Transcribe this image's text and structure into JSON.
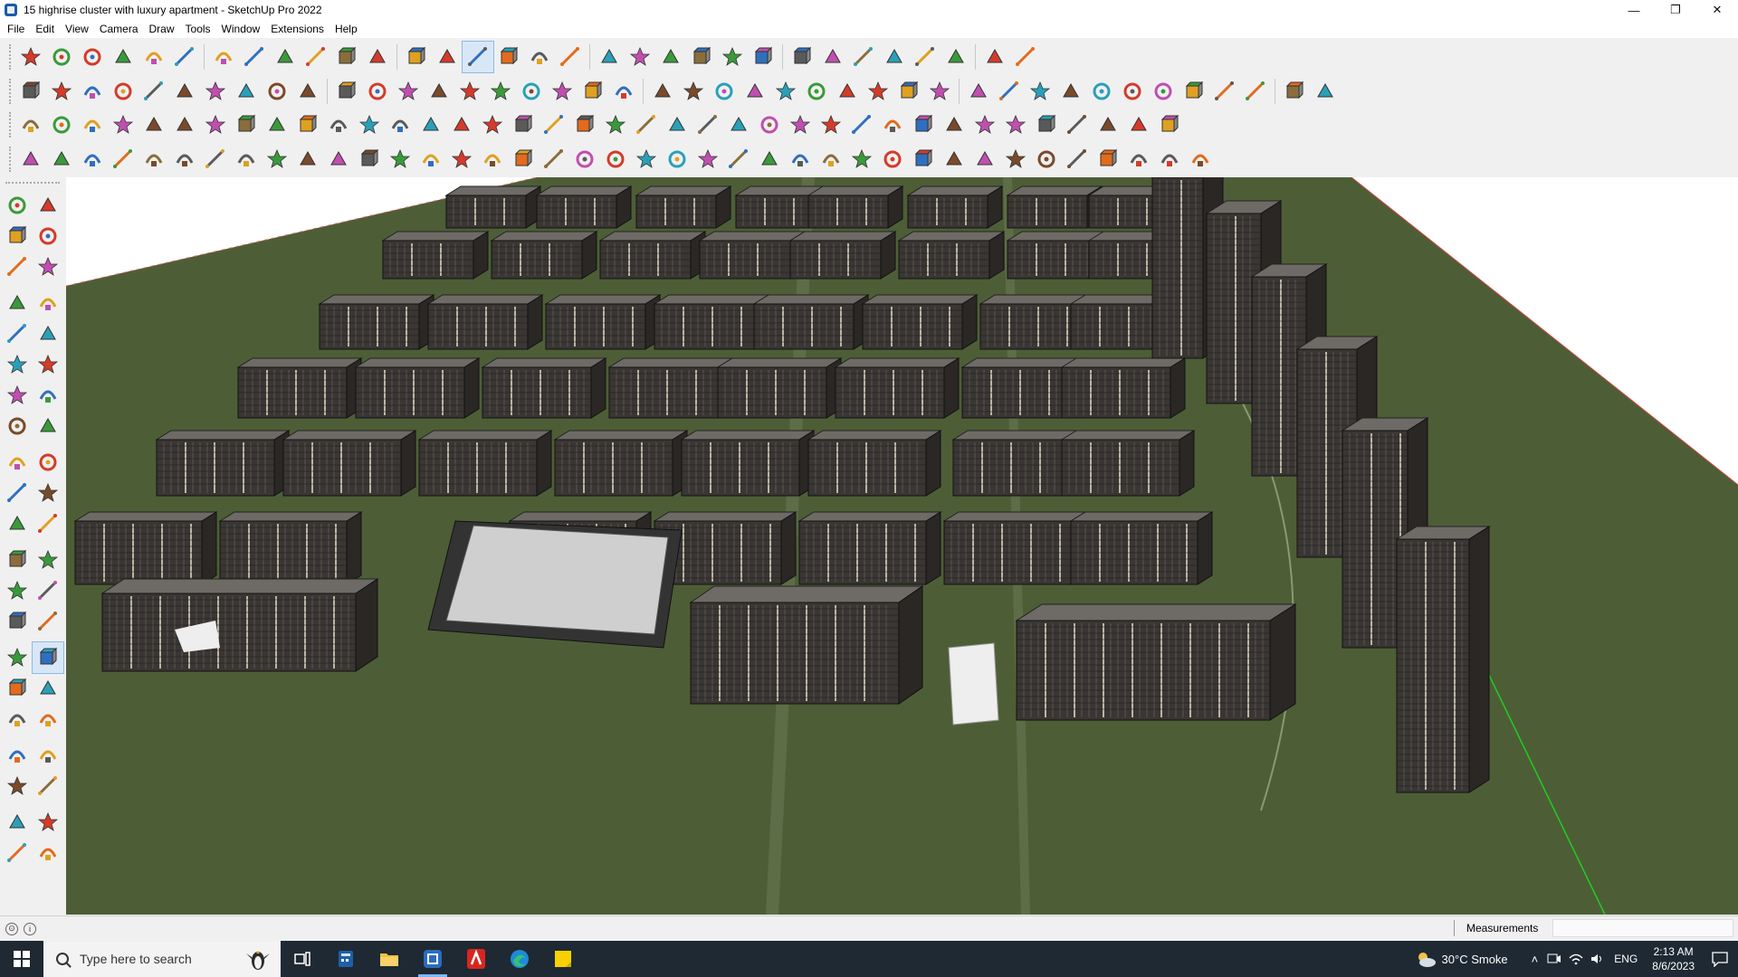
{
  "window": {
    "title": "15 highrise cluster with luxury apartment - SketchUp Pro 2022",
    "minimize_glyph": "—",
    "restore_glyph": "❐",
    "close_glyph": "✕"
  },
  "menu": [
    "File",
    "Edit",
    "View",
    "Camera",
    "Draw",
    "Tools",
    "Window",
    "Extensions",
    "Help"
  ],
  "toolbar_icons": {
    "row1": [
      "zoom-search-icon",
      "select-arrow-icon",
      "eraser-icon",
      "pencil-line-icon",
      "freehand-icon",
      "rectangle-icon",
      "move-icon",
      "rotate-icon",
      "scale-icon",
      "offset-icon",
      "tape-measure-icon",
      "text-label-icon",
      "paint-bucket-icon",
      "orbit-icon",
      "pan-icon",
      "zoom-icon",
      "zoom-extents-icon",
      "component-icon",
      "section-plane-icon",
      "layers-icon",
      "styles-icon",
      "account-icon",
      "scene-icon",
      "color-icon",
      "axes-icon",
      "sort-up-icon",
      "sort-down-icon",
      "expand-icon",
      "fit-icon",
      "undo-icon",
      "redo-icon",
      "share-icon"
    ],
    "row2": [
      "box-solid-icon",
      "box-xray-icon",
      "box-shaded-icon",
      "push-pull-icon",
      "extrude-icon",
      "bevel-icon",
      "chamfer-icon",
      "fillet-icon",
      "shell-icon",
      "split-icon",
      "curve-icon",
      "plane-icon",
      "plane-alt-icon",
      "plane-mirror-icon",
      "roof-icon",
      "roof-alt-icon",
      "house-icon",
      "house-alt-icon",
      "house-outline-icon",
      "garage-icon",
      "formula-icon",
      "leaf-icon",
      "ruler-icon",
      "ellipse-icon",
      "circle-icon",
      "hexagon-icon",
      "oval-icon",
      "polygon-icon",
      "wave-icon",
      "arc-icon",
      "freeform-icon",
      "stamp-icon",
      "knot-icon",
      "red-line-icon",
      "tag-icon",
      "cube-brown-icon",
      "grid-icon",
      "mesh-icon",
      "terrain-icon",
      "teapot-icon",
      "box-flat-icon",
      "box-render-icon"
    ],
    "row3": [
      "blue-plane-icon",
      "blue-solid-icon",
      "yellow-plane-icon",
      "green-plane-icon",
      "red-plane-icon",
      "white-plane-icon",
      "loop-icon",
      "red-square-icon",
      "stack-icon",
      "path-icon",
      "bridge-icon",
      "pipe-icon",
      "corner-icon",
      "dotted-curve-icon",
      "red-cross-icon",
      "green-cross-icon",
      "blue-cross-icon",
      "cone-icon",
      "water-icon",
      "warning-icon",
      "hook-icon",
      "wave-orange-icon",
      "spiral-icon",
      "arrows-icon",
      "bucket-icon",
      "magnet-icon",
      "tree-icon",
      "chain-icon",
      "bolt-icon",
      "cube-red-icon",
      "lattice-icon",
      "window-icon",
      "tile-icon",
      "grid-orange-icon",
      "waffle-icon",
      "scatter-icon",
      "curve-dotted-icon",
      "qr-icon"
    ],
    "row4": [
      "node-icon",
      "dotted-path-icon",
      "drill-icon",
      "scissors-icon",
      "gear-icon",
      "loop-arrows-icon",
      "coil-icon",
      "sphere-icon",
      "knot-alt-icon",
      "ribbon-icon",
      "corner-line-icon",
      "angle-icon",
      "red-line-alt-icon",
      "bend-icon",
      "column-icon",
      "tent-icon",
      "fence-icon",
      "bridge-alt-icon",
      "web-icon",
      "stairs-icon",
      "ladder-icon",
      "rail-icon",
      "ramp-icon",
      "beam-icon",
      "zigzag-icon",
      "stripe-icon",
      "stripe-alt-icon",
      "drum-icon",
      "stairs-alt-icon",
      "truss-icon",
      "shaft-icon",
      "hatch-icon",
      "hatch-alt-icon",
      "grid-lines-icon",
      "fan-icon",
      "fan-alt-icon",
      "sail-icon",
      "wing-icon",
      "shape-icon"
    ]
  },
  "left_tools": [
    [
      "select-arrow-icon",
      "orbit-icon"
    ],
    [
      "paint-bucket-icon",
      "eraser-icon"
    ],
    [
      "component-icon",
      "tape-icon"
    ],
    [
      "pencil-line-icon",
      "freehand-icon"
    ],
    [
      "rectangle-icon",
      "rotated-rect-icon"
    ],
    [
      "circle-icon",
      "polygon-icon"
    ],
    [
      "arc-icon",
      "arc-2pt-icon"
    ],
    [
      "arc-3pt-icon",
      "pie-icon"
    ],
    [
      "move-icon",
      "push-pull-icon"
    ],
    [
      "rotate-icon",
      "follow-me-icon"
    ],
    [
      "scale-icon",
      "offset-icon"
    ],
    [
      "tape-measure-icon",
      "dimension-icon"
    ],
    [
      "protractor-icon",
      "text-icon"
    ],
    [
      "axes-icon",
      "3d-text-icon"
    ],
    [
      "orbit-alt-icon",
      "pan-hand-icon"
    ],
    [
      "zoom-icon",
      "zoom-window-icon"
    ],
    [
      "zoom-extents-icon",
      "previous-view-icon"
    ],
    [
      "walk-icon",
      "look-around-icon"
    ],
    [
      "footprints-icon",
      "position-camera-icon"
    ],
    [
      "section-plane-icon",
      "section-display-icon"
    ],
    [
      "section-cuts-icon",
      "section-fill-icon"
    ]
  ],
  "status": {
    "measurements_label": "Measurements",
    "measurements_value": ""
  },
  "taskbar": {
    "search_placeholder": "Type here to search",
    "apps": [
      "task-view-icon",
      "calculator-icon",
      "file-explorer-icon",
      "sketchup-icon",
      "acrobat-icon",
      "edge-icon",
      "sticky-notes-icon"
    ],
    "weather": "30°C  Smoke",
    "language": "ENG",
    "time": "2:13 AM",
    "date": "8/6/2023"
  },
  "colors": {
    "ground": "#4d5e37",
    "ground_light": "#5a6b40",
    "building_roof": "#6e6a66",
    "building_wall": "#3a3634",
    "podium_roof": "#cfcfcf",
    "sky": "#ffffff",
    "taskbar": "#1f2933",
    "accent": "#7cb7f2"
  }
}
